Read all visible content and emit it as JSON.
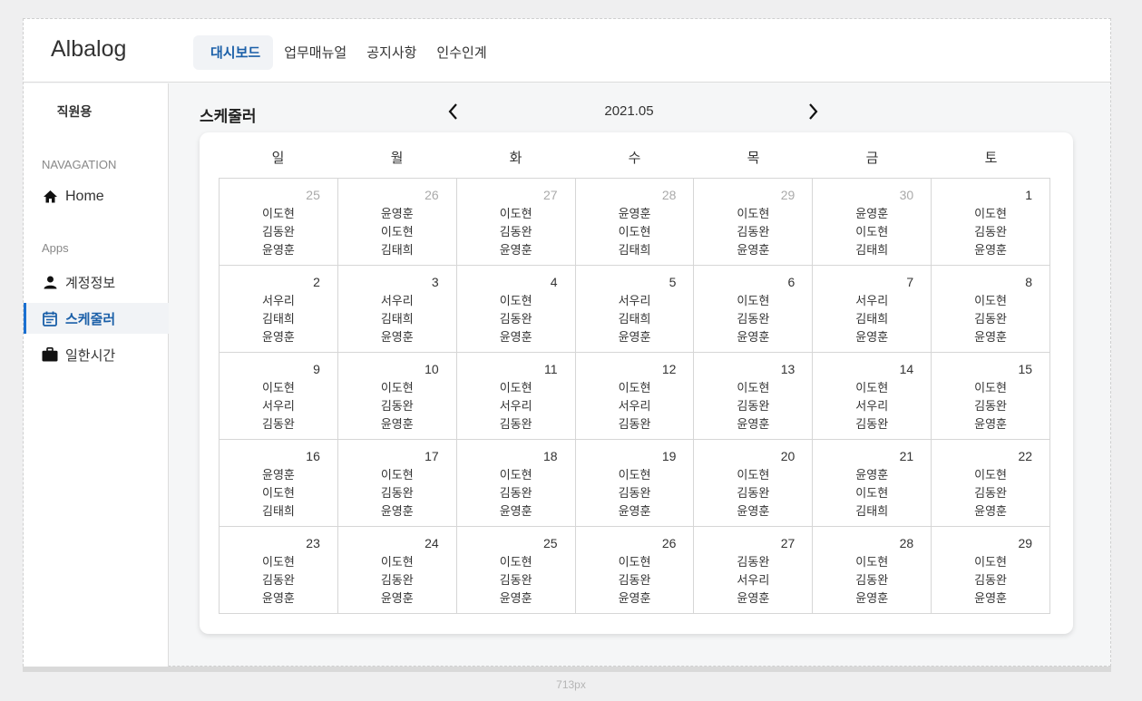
{
  "app": {
    "logo": "Albalog"
  },
  "nav": {
    "tabs": [
      {
        "label": "대시보드",
        "active": true
      },
      {
        "label": "업무매뉴얼",
        "active": false
      },
      {
        "label": "공지사항",
        "active": false
      },
      {
        "label": "인수인계",
        "active": false
      }
    ]
  },
  "sidebar": {
    "title": "직원용",
    "navigation_label": "NAVAGATION",
    "home_label": "Home",
    "apps_label": "Apps",
    "items": [
      {
        "label": "계정정보",
        "icon": "person-icon"
      },
      {
        "label": "스케줄러",
        "icon": "calendar-icon",
        "active": true
      },
      {
        "label": "일한시간",
        "icon": "briefcase-icon"
      }
    ]
  },
  "scheduler": {
    "title": "스케줄러",
    "month": "2021.05",
    "weekdays": [
      "일",
      "월",
      "화",
      "수",
      "목",
      "금",
      "토"
    ],
    "weeks": [
      [
        {
          "day": "25",
          "prev": true,
          "names": [
            "이도현",
            "김동완",
            "윤영훈"
          ]
        },
        {
          "day": "26",
          "prev": true,
          "names": [
            "윤영훈",
            "이도현",
            "김태희"
          ]
        },
        {
          "day": "27",
          "prev": true,
          "names": [
            "이도현",
            "김동완",
            "윤영훈"
          ]
        },
        {
          "day": "28",
          "prev": true,
          "names": [
            "윤영훈",
            "이도현",
            "김태희"
          ]
        },
        {
          "day": "29",
          "prev": true,
          "names": [
            "이도현",
            "김동완",
            "윤영훈"
          ]
        },
        {
          "day": "30",
          "prev": true,
          "names": [
            "윤영훈",
            "이도현",
            "김태희"
          ]
        },
        {
          "day": "1",
          "names": [
            "이도현",
            "김동완",
            "윤영훈"
          ]
        }
      ],
      [
        {
          "day": "2",
          "names": [
            "서우리",
            "김태희",
            "윤영훈"
          ]
        },
        {
          "day": "3",
          "names": [
            "서우리",
            "김태희",
            "윤영훈"
          ]
        },
        {
          "day": "4",
          "names": [
            "이도현",
            "김동완",
            "윤영훈"
          ]
        },
        {
          "day": "5",
          "names": [
            "서우리",
            "김태희",
            "윤영훈"
          ]
        },
        {
          "day": "6",
          "names": [
            "이도현",
            "김동완",
            "윤영훈"
          ]
        },
        {
          "day": "7",
          "names": [
            "서우리",
            "김태희",
            "윤영훈"
          ]
        },
        {
          "day": "8",
          "names": [
            "이도현",
            "김동완",
            "윤영훈"
          ]
        }
      ],
      [
        {
          "day": "9",
          "names": [
            "이도현",
            "서우리",
            "김동완"
          ]
        },
        {
          "day": "10",
          "names": [
            "이도현",
            "김동완",
            "윤영훈"
          ]
        },
        {
          "day": "11",
          "names": [
            "이도현",
            "서우리",
            "김동완"
          ]
        },
        {
          "day": "12",
          "names": [
            "이도현",
            "서우리",
            "김동완"
          ]
        },
        {
          "day": "13",
          "names": [
            "이도현",
            "김동완",
            "윤영훈"
          ]
        },
        {
          "day": "14",
          "names": [
            "이도현",
            "서우리",
            "김동완"
          ]
        },
        {
          "day": "15",
          "names": [
            "이도현",
            "김동완",
            "윤영훈"
          ]
        }
      ],
      [
        {
          "day": "16",
          "names": [
            "윤영훈",
            "이도현",
            "김태희"
          ]
        },
        {
          "day": "17",
          "names": [
            "이도현",
            "김동완",
            "윤영훈"
          ]
        },
        {
          "day": "18",
          "names": [
            "이도현",
            "김동완",
            "윤영훈"
          ]
        },
        {
          "day": "19",
          "names": [
            "이도현",
            "김동완",
            "윤영훈"
          ]
        },
        {
          "day": "20",
          "names": [
            "이도현",
            "김동완",
            "윤영훈"
          ]
        },
        {
          "day": "21",
          "names": [
            "윤영훈",
            "이도현",
            "김태희"
          ]
        },
        {
          "day": "22",
          "names": [
            "이도현",
            "김동완",
            "윤영훈"
          ]
        }
      ],
      [
        {
          "day": "23",
          "names": [
            "이도현",
            "김동완",
            "윤영훈"
          ]
        },
        {
          "day": "24",
          "names": [
            "이도현",
            "김동완",
            "윤영훈"
          ]
        },
        {
          "day": "25",
          "names": [
            "이도현",
            "김동완",
            "윤영훈"
          ]
        },
        {
          "day": "26",
          "names": [
            "이도현",
            "김동완",
            "윤영훈"
          ]
        },
        {
          "day": "27",
          "names": [
            "김동완",
            "서우리",
            "윤영훈"
          ]
        },
        {
          "day": "28",
          "names": [
            "이도현",
            "김동완",
            "윤영훈"
          ]
        },
        {
          "day": "29",
          "names": [
            "이도현",
            "김동완",
            "윤영훈"
          ]
        }
      ]
    ]
  },
  "viewport_label": "713px",
  "colors": {
    "accent": "#1a5fa8",
    "active_bg": "#f1f3f6",
    "border": "#d6d6d6"
  }
}
